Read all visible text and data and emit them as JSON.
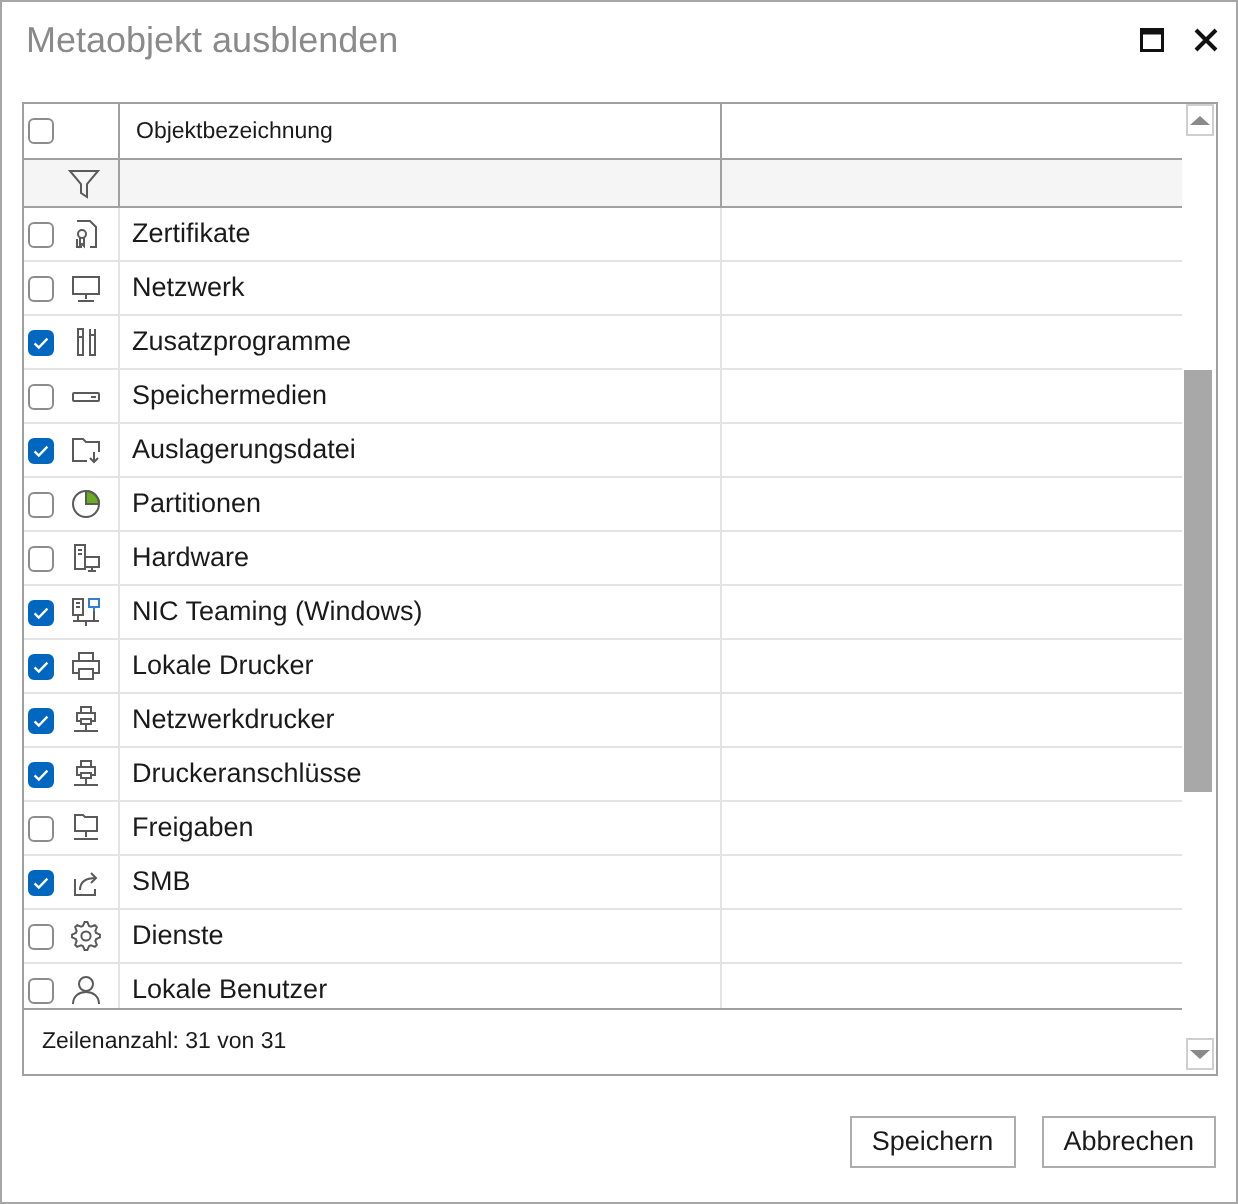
{
  "window": {
    "title": "Metaobjekt ausblenden"
  },
  "table": {
    "select_all": {
      "checked": false
    },
    "columns": [
      {
        "label": "Objektbezeichnung"
      }
    ],
    "rows": [
      {
        "kind": "certificate",
        "name": "Zertifikate",
        "checked": false
      },
      {
        "kind": "monitor",
        "name": "Netzwerk",
        "checked": false
      },
      {
        "kind": "tools",
        "name": "Zusatzprogramme",
        "checked": true
      },
      {
        "kind": "drive",
        "name": "Speichermedien",
        "checked": false
      },
      {
        "kind": "folder",
        "name": "Auslagerungsdatei",
        "checked": true
      },
      {
        "kind": "pie",
        "name": "Partitionen",
        "checked": false
      },
      {
        "kind": "hardware",
        "name": "Hardware",
        "checked": false
      },
      {
        "kind": "team",
        "name": "NIC Teaming (Windows)",
        "checked": true
      },
      {
        "kind": "printer",
        "name": "Lokale Drucker",
        "checked": true
      },
      {
        "kind": "netprinter",
        "name": "Netzwerkdrucker",
        "checked": true
      },
      {
        "kind": "netprinter",
        "name": "Druckeranschlüsse",
        "checked": true
      },
      {
        "kind": "netfolder",
        "name": "Freigaben",
        "checked": false
      },
      {
        "kind": "share",
        "name": "SMB",
        "checked": true
      },
      {
        "kind": "gear",
        "name": "Dienste",
        "checked": false
      },
      {
        "kind": "user",
        "name": "Lokale Benutzer",
        "checked": false
      }
    ],
    "row_count": "Zeilenanzahl: 31 von 31"
  },
  "buttons": [
    {
      "label": "Speichern"
    },
    {
      "label": "Abbrechen"
    }
  ]
}
